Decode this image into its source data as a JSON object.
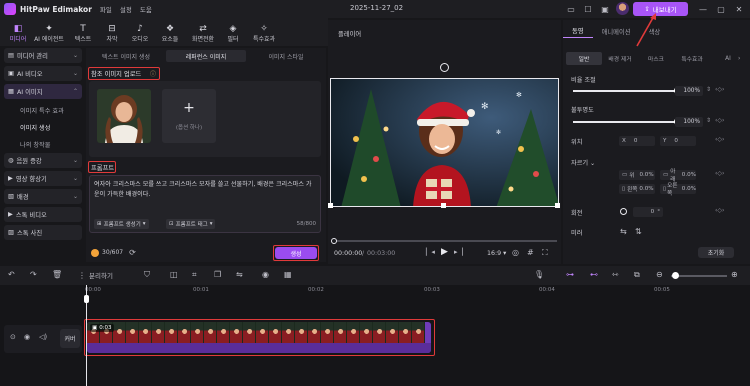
{
  "app": {
    "name": "HitPaw Edimakor",
    "menu": [
      "파일",
      "설정",
      "도움"
    ],
    "project": "2025-11-27_02",
    "export_label": "내보내기"
  },
  "toolbar": {
    "items": [
      {
        "label": "미디어",
        "icon": "media-icon"
      },
      {
        "label": "AI 에이전트",
        "icon": "ai-agent-icon"
      },
      {
        "label": "텍스트",
        "icon": "text-icon"
      },
      {
        "label": "자막",
        "icon": "subtitle-icon"
      },
      {
        "label": "오디오",
        "icon": "audio-icon"
      },
      {
        "label": "요소들",
        "icon": "elements-icon"
      },
      {
        "label": "화면전환",
        "icon": "transition-icon"
      },
      {
        "label": "필터",
        "icon": "filter-icon"
      },
      {
        "label": "특수효과",
        "icon": "effects-icon"
      }
    ]
  },
  "sidebar": {
    "items": [
      {
        "label": "미디어 관리",
        "type": "item"
      },
      {
        "label": "AI 비디오",
        "type": "item"
      },
      {
        "label": "AI 이미지",
        "type": "item",
        "selected": true
      },
      {
        "label": "이미지 특수 효과",
        "type": "sub"
      },
      {
        "label": "이미지 생성",
        "type": "sub",
        "selected": true
      },
      {
        "label": "나의 창작물",
        "type": "sub"
      },
      {
        "label": "음원 증강",
        "type": "item"
      },
      {
        "label": "영상 향상기",
        "type": "item"
      },
      {
        "label": "배경",
        "type": "item"
      },
      {
        "label": "스톡 비디오",
        "type": "item"
      },
      {
        "label": "스톡 사진",
        "type": "item"
      }
    ]
  },
  "panel": {
    "tabs": [
      "텍스트 이미지 생성",
      "레퍼런스 이미지",
      "이미지 스타일"
    ],
    "upload_label": "참조 이미지 업로드",
    "optional_label": "(옵션 하나)",
    "prompt_label": "프롬프트",
    "prompt_text": "여자아 크리스마스 모를 쓰고 크리스마스 모자를 쓸고 선물하기, 배경은 크리스마스 가운이 가득한 배경이다.",
    "prompt_gen_chip": "프롬프트 생성기",
    "prompt_tag_chip": "프롬프트 태그",
    "char_count": "58/800",
    "credits": "30/607",
    "generate_label": "생성"
  },
  "player": {
    "label": "플레이어",
    "time_current": "00:00:00",
    "time_total": "00:03:00",
    "ratio": "16:9"
  },
  "properties": {
    "tabs": [
      "동영",
      "애니메이션",
      "색상"
    ],
    "subtabs": [
      "일반",
      "배경 제거",
      "마스크",
      "특수효과",
      "AI"
    ],
    "opacity_label": "비율 조절",
    "opacity_value": "100%",
    "opacity_level": 1.0,
    "blur_label": "불투명도",
    "blur_value": "100%",
    "blur_level": 1.0,
    "position_label": "위치",
    "pos_x_label": "X",
    "pos_x": "0",
    "pos_y_label": "Y",
    "pos_y": "0",
    "crop_label": "자르기",
    "crop_fields": [
      {
        "label": "위",
        "value": "0.0%"
      },
      {
        "label": "아래",
        "value": "0.0%"
      },
      {
        "label": "왼쪽",
        "value": "0.0%"
      },
      {
        "label": "오른쪽",
        "value": "0.0%"
      }
    ],
    "rotate_label": "회전",
    "rotate_value": "0",
    "rotate_unit": "°",
    "mirror_label": "미러",
    "reset_label": "초기화"
  },
  "timeline": {
    "split_label": "분리하기",
    "ruler": [
      "00:00",
      "00:01",
      "00:02",
      "00:03",
      "00:04",
      "00:05"
    ],
    "track_label": "커버",
    "clip_duration": "0:03"
  }
}
